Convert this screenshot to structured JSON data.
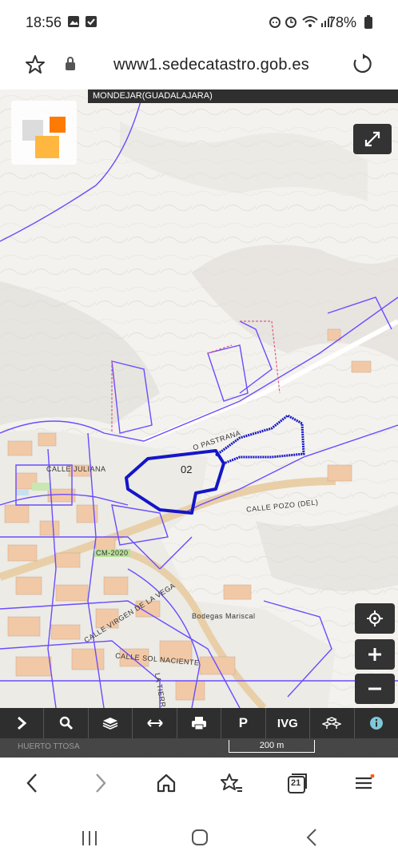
{
  "status_bar": {
    "time": "18:56",
    "battery": "78%"
  },
  "browser": {
    "url": "www1.sedecatastro.gob.es",
    "tabs_count": "21"
  },
  "map": {
    "municipality": "MONDEJAR(GUADALAJARA)",
    "parcel_label": "02",
    "labels": {
      "calle_pastrana": "O PASTRANA",
      "calle_juliana": "CALLE JULIANA",
      "calle_pozo": "CALLE POZO (DEL)",
      "road_cm": "CM-2020",
      "calle_virgen": "CALLE VIRGEN DE LA VEGA",
      "calle_sol": "CALLE SOL NACIENTE",
      "bodegas": "Bodegas Mariscal",
      "tierra": "LA TIERRA",
      "coord": "HUERTO TTOSA"
    },
    "scale_label": "200 m",
    "parcel_color": "#1515c8",
    "cadastre_color": "#6a4cff"
  },
  "toolbar": {
    "ivg": "IVG",
    "parking": "P",
    "items": [
      "expand",
      "search",
      "layers",
      "measure",
      "print",
      "parking",
      "ivg",
      "3d",
      "info"
    ]
  }
}
